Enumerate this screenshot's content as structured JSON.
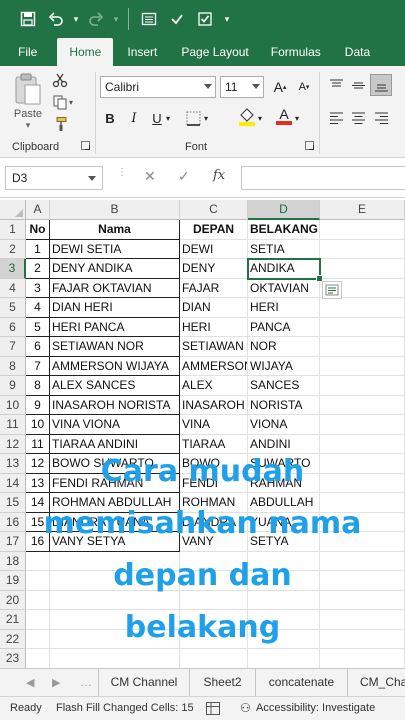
{
  "ribbon_tabs": [
    "File",
    "Home",
    "Insert",
    "Page Layout",
    "Formulas",
    "Data"
  ],
  "active_tab": "Home",
  "clipboard": {
    "paste_label": "Paste",
    "group_label": "Clipboard"
  },
  "font": {
    "name": "Calibri",
    "size": "11",
    "group_label": "Font",
    "bold": "B",
    "italic": "I",
    "underline": "U",
    "font_color_letter": "A"
  },
  "formula_bar": {
    "name_box": "D3",
    "fx": "fx",
    "cancel": "✕",
    "enter": "✓",
    "value": ""
  },
  "columns": [
    "A",
    "B",
    "C",
    "D",
    "E"
  ],
  "selected_column": "D",
  "selected_row": 3,
  "rows": [
    "1",
    "2",
    "3",
    "4",
    "5",
    "6",
    "7",
    "8",
    "9",
    "10",
    "11",
    "12",
    "13",
    "14",
    "15",
    "16",
    "17",
    "18",
    "19",
    "20",
    "21",
    "22",
    "23"
  ],
  "headers": {
    "no": "No",
    "nama": "Nama",
    "depan": "DEPAN",
    "belakang": "BELAKANG"
  },
  "table": [
    {
      "no": "1",
      "nama": "DEWI SETIA",
      "depan": "DEWI",
      "belakang": "SETIA"
    },
    {
      "no": "2",
      "nama": "DENY ANDIKA",
      "depan": "DENY",
      "belakang": "ANDIKA"
    },
    {
      "no": "3",
      "nama": "FAJAR OKTAVIAN",
      "depan": "FAJAR",
      "belakang": "OKTAVIAN"
    },
    {
      "no": "4",
      "nama": "DIAN HERI",
      "depan": "DIAN",
      "belakang": "HERI"
    },
    {
      "no": "5",
      "nama": "HERI PANCA",
      "depan": "HERI",
      "belakang": "PANCA"
    },
    {
      "no": "6",
      "nama": "SETIAWAN NOR",
      "depan": "SETIAWAN",
      "belakang": "NOR"
    },
    {
      "no": "7",
      "nama": "AMMERSON WIJAYA",
      "depan": "AMMERSON",
      "belakang": "WIJAYA"
    },
    {
      "no": "8",
      "nama": "ALEX SANCES",
      "depan": "ALEX",
      "belakang": "SANCES"
    },
    {
      "no": "9",
      "nama": "INASAROH NORISTA",
      "depan": "INASAROH",
      "belakang": "NORISTA"
    },
    {
      "no": "10",
      "nama": "VINA VIONA",
      "depan": "VINA",
      "belakang": "VIONA"
    },
    {
      "no": "11",
      "nama": "TIARAA ANDINI",
      "depan": "TIARAA",
      "belakang": "ANDINI"
    },
    {
      "no": "12",
      "nama": "BOWO SUWARTO",
      "depan": "BOWO",
      "belakang": "SUWARTO"
    },
    {
      "no": "13",
      "nama": "FENDI RAHMAN",
      "depan": "FENDI",
      "belakang": "RAHMAN"
    },
    {
      "no": "14",
      "nama": "ROHMAN ABDULLAH",
      "depan": "ROHMAN",
      "belakang": "ABDULLAH"
    },
    {
      "no": "15",
      "nama": "DIANDRA YUANA",
      "depan": "DIANDRA",
      "belakang": "YUANA"
    },
    {
      "no": "16",
      "nama": "VANY SETYA",
      "depan": "VANY",
      "belakang": "SETYA"
    }
  ],
  "overlay_text": [
    "Cara mudah",
    "memisahkan nama",
    "depan dan",
    "belakang"
  ],
  "sheet_tabs": [
    "CM Channel",
    "Sheet2",
    "concatenate",
    "CM_Cha"
  ],
  "status": {
    "ready": "Ready",
    "flash_fill": "Flash Fill Changed Cells: 15",
    "accessibility": "Accessibility: Investigate"
  },
  "colors": {
    "excel_green": "#217346",
    "overlay_blue": "#1fa0e8",
    "font_color_bar": "#e03020",
    "highlight_bar": "#ffeb00"
  }
}
